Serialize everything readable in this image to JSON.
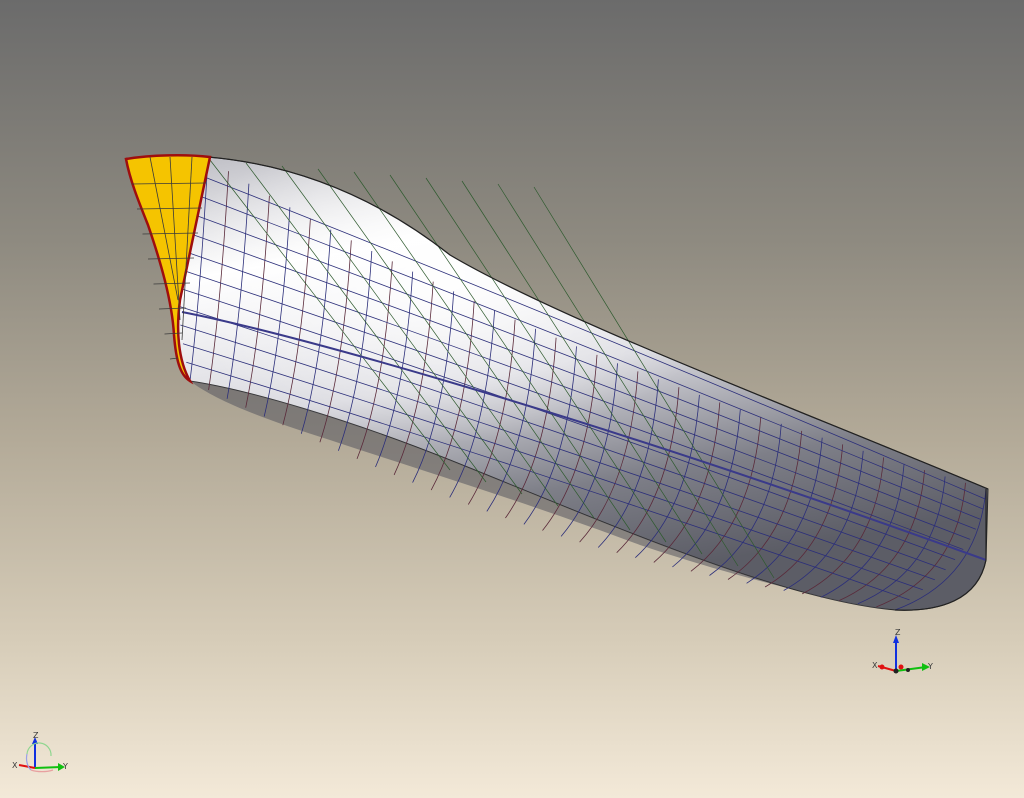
{
  "viewer": {
    "background_top": "#6b6b6b",
    "background_bottom": "#f3e9d8"
  },
  "model": {
    "hull_color": "#d9d9de",
    "hull_highlight": "#ffffff",
    "grid_color_1": "#2c2f7a",
    "grid_color_2": "#5a2a3a",
    "diagonal_color": "#2e5a2e",
    "transom_fill": "#f5c400",
    "transom_edge": "#9e0e0e"
  },
  "triad_local": {
    "icon": "axis-triad-icon",
    "x_label": "X",
    "y_label": "Y",
    "z_label": "Z",
    "x_color": "#e01010",
    "y_color": "#10c010",
    "z_color": "#1030e0"
  },
  "triad_global": {
    "icon": "axis-triad-icon",
    "x_label": "X",
    "y_label": "Y",
    "z_label": "Z",
    "x_color": "#e01010",
    "y_color": "#10c010",
    "z_color": "#1030e0"
  }
}
